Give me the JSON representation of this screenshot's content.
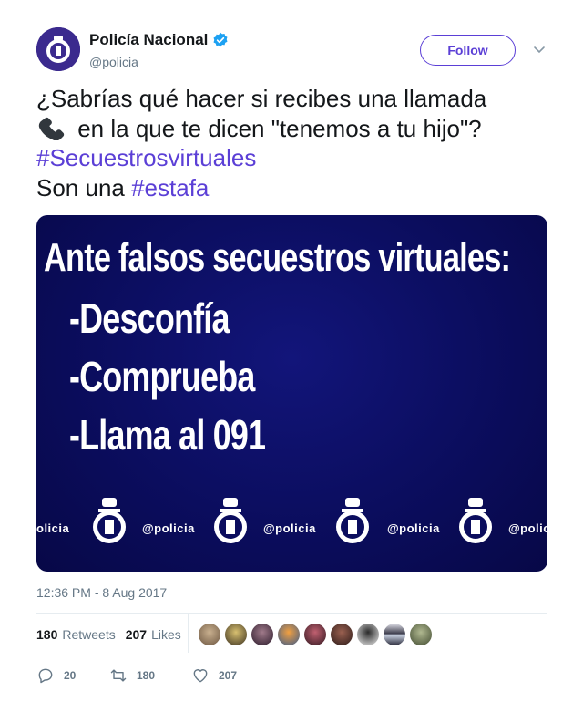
{
  "user": {
    "display_name": "Policía Nacional",
    "handle": "@policia",
    "verified_icon": "verified-badge-icon",
    "follow_label": "Follow"
  },
  "tweet": {
    "line1": "¿Sabrías qué hacer si recibes una llamada",
    "line2": " en la que te dicen \"tenemos a tu hijo\"?",
    "line3_hashtag": "#Secuestrosvirtuales",
    "line4_prefix": "Son una ",
    "line4_hashtag": "#estafa",
    "emoji_icon": "telephone-receiver-icon"
  },
  "media": {
    "headline": "Ante falsos secuestros virtuales:",
    "bullets": [
      "-Desconfía",
      "-Comprueba",
      "-Llama al 091"
    ],
    "strip_word": "policia",
    "strip_word_partial_left": "olicia",
    "strip_word_partial_right": "@polic",
    "strip_word_at": "@policia"
  },
  "timestamp": "12:36 PM - 8 Aug 2017",
  "stats": {
    "retweets_count": "180",
    "retweets_label": "Retweets",
    "likes_count": "207",
    "likes_label": "Likes"
  },
  "actions": {
    "replies": "20",
    "retweets": "180",
    "likes": "207"
  },
  "colors": {
    "accent": "#5b3fd6",
    "media_bg": "#0b0d5e",
    "muted": "#657786"
  }
}
